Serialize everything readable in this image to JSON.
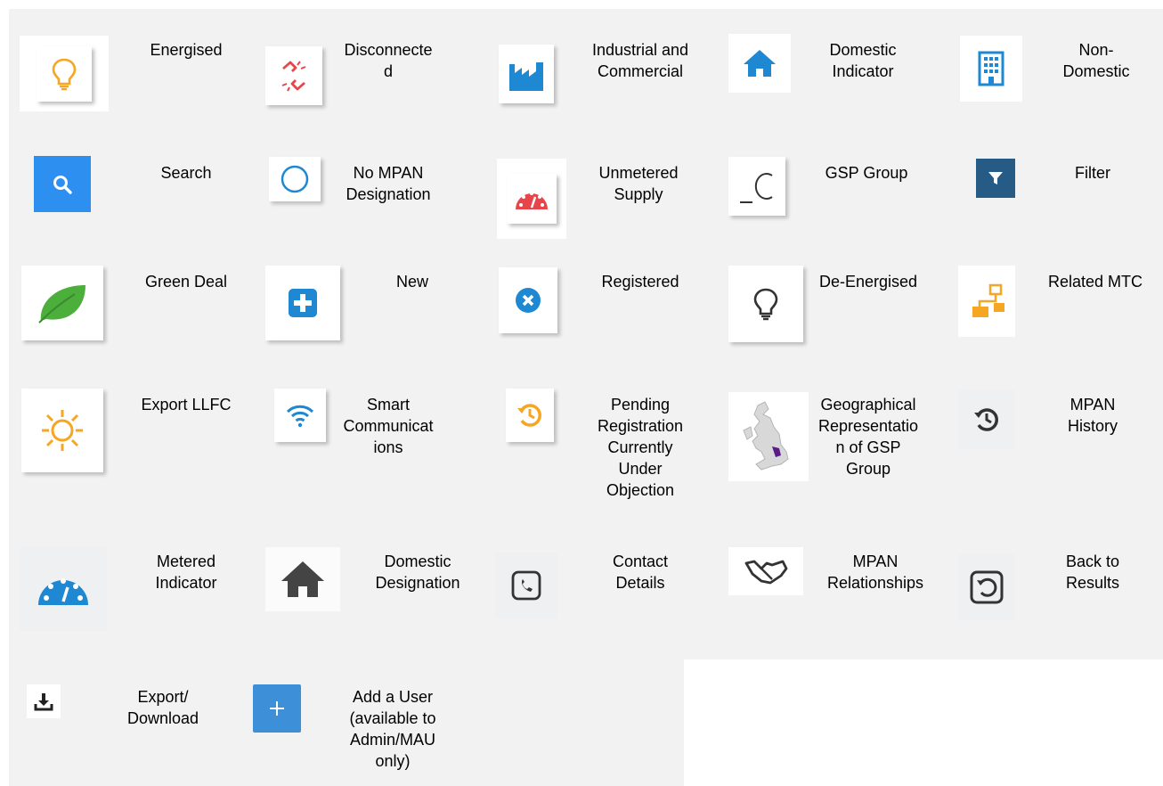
{
  "legend": [
    {
      "icon": "bulb-icon",
      "label": "Energised"
    },
    {
      "icon": "broken-link-icon",
      "label": "Disconnecte\nd"
    },
    {
      "icon": "factory-icon",
      "label": "Industrial and\nCommercial"
    },
    {
      "icon": "house-icon",
      "label": "Domestic\nIndicator"
    },
    {
      "icon": "office-building-icon",
      "label": "Non-\nDomestic"
    },
    {
      "icon": "search-icon",
      "label": "Search"
    },
    {
      "icon": "circle-icon",
      "label": "No MPAN\nDesignation"
    },
    {
      "icon": "speedometer-icon",
      "label": "Unmetered\nSupply"
    },
    {
      "icon": "gsp-c-icon",
      "label": "GSP Group"
    },
    {
      "icon": "filter-icon",
      "label": "Filter"
    },
    {
      "icon": "leaf-icon",
      "label": "Green Deal"
    },
    {
      "icon": "plus-square-icon",
      "label": "New"
    },
    {
      "icon": "x-circle-icon",
      "label": "Registered"
    },
    {
      "icon": "bulb-outline-icon",
      "label": "De-Energised"
    },
    {
      "icon": "sitemap-icon",
      "label": "Related MTC"
    },
    {
      "icon": "sun-icon",
      "label": "Export LLFC"
    },
    {
      "icon": "wifi-icon",
      "label": "Smart\nCommunicat\nions"
    },
    {
      "icon": "history-icon",
      "label": "Pending\nRegistration\nCurrently\nUnder\nObjection"
    },
    {
      "icon": "uk-map-icon",
      "label": "Geographical\nRepresentatio\nn of GSP\nGroup"
    },
    {
      "icon": "history-icon",
      "label": "MPAN\nHistory"
    },
    {
      "icon": "speedometer-icon",
      "label": "Metered\nIndicator"
    },
    {
      "icon": "house-icon",
      "label": "Domestic\nDesignation"
    },
    {
      "icon": "phone-square-icon",
      "label": "Contact\nDetails"
    },
    {
      "icon": "handshake-icon",
      "label": "MPAN\nRelationships"
    },
    {
      "icon": "undo-square-icon",
      "label": "Back to\nResults"
    },
    {
      "icon": "download-icon",
      "label": "Export/\nDownload"
    },
    {
      "icon": "plus-icon",
      "label": "Add a User\n(available to\nAdmin/MAU\nonly)"
    }
  ],
  "colors": {
    "orange": "#f5a623",
    "red": "#e8454a",
    "blue": "#1e88d2",
    "navy": "#265b86",
    "green": "#4caf3c",
    "dark": "#333333",
    "panel": "#f2f2f2"
  }
}
